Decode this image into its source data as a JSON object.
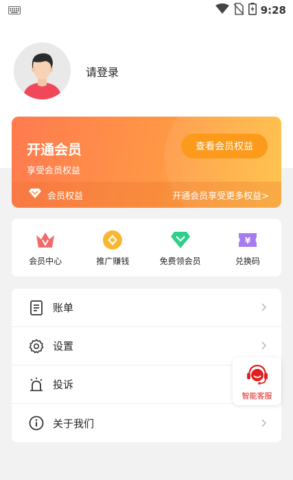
{
  "status_bar": {
    "time": "9:28"
  },
  "profile": {
    "login_text": "请登录"
  },
  "vip_card": {
    "title": "开通会员",
    "subtitle": "享受会员权益",
    "button_label": "查看会员权益",
    "benefits_label": "会员权益",
    "promo_text": "开通会员享受更多权益>"
  },
  "quick_menu": [
    {
      "label": "会员中心",
      "icon": "crown-icon"
    },
    {
      "label": "推广赚钱",
      "icon": "coin-icon"
    },
    {
      "label": "免费领会员",
      "icon": "diamond-icon"
    },
    {
      "label": "兑换码",
      "icon": "ticket-icon"
    }
  ],
  "menu_list": [
    {
      "label": "账单",
      "icon": "bill-icon"
    },
    {
      "label": "设置",
      "icon": "gear-icon"
    },
    {
      "label": "投诉",
      "icon": "alarm-icon"
    },
    {
      "label": "关于我们",
      "icon": "info-icon"
    }
  ],
  "customer_service": {
    "label": "智能客服"
  },
  "colors": {
    "vip_gradient_start": "#ff7a50",
    "vip_gradient_end": "#ffc040",
    "vip_button": "#fb9a1b",
    "service_red": "#e02020"
  }
}
